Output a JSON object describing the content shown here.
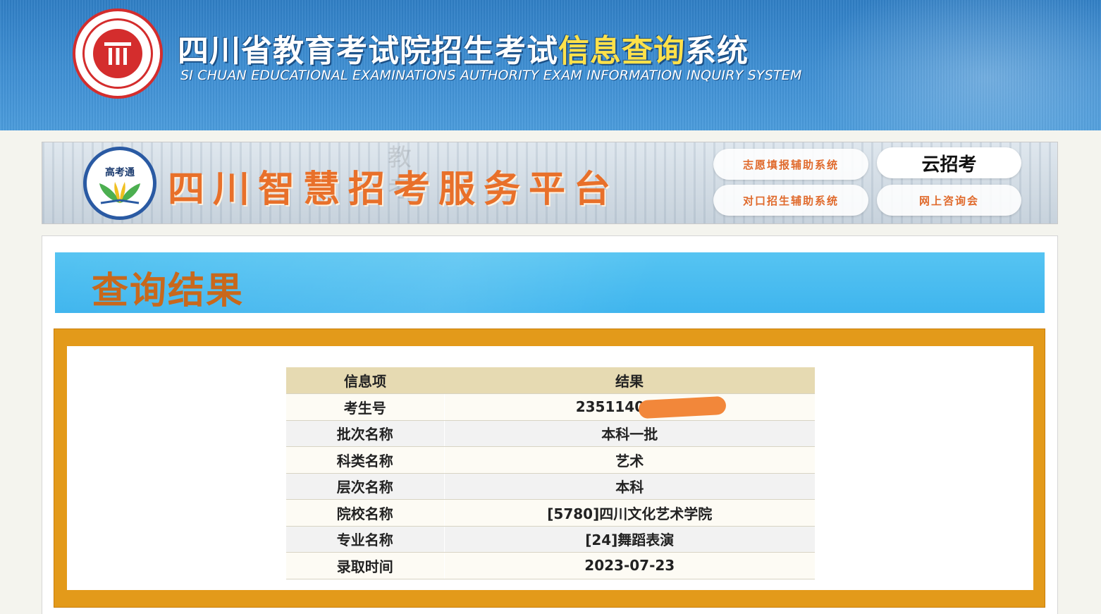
{
  "header": {
    "title_part1": "四川省教育考试院招生考试",
    "title_highlight": "信息查询",
    "title_part2": "系统",
    "subtitle": "SI CHUAN EDUCATIONAL EXAMINATIONS AUTHORITY EXAM INFORMATION INQUIRY SYSTEM"
  },
  "banner": {
    "logo_text": "高考通",
    "title": "四川智慧招考服务平台",
    "buttons": {
      "zhiyuan": "志愿填报辅助系统",
      "duikou": "对口招生辅助系统",
      "yunzhaokao": "云招考",
      "wangshang": "网上咨询会"
    }
  },
  "result": {
    "title": "查询结果",
    "columns": [
      "信息项",
      "结果"
    ],
    "rows": [
      {
        "label": "考生号",
        "value": "23511401139"
      },
      {
        "label": "批次名称",
        "value": "本科一批"
      },
      {
        "label": "科类名称",
        "value": "艺术"
      },
      {
        "label": "层次名称",
        "value": "本科"
      },
      {
        "label": "院校名称",
        "value": "[5780]四川文化艺术学院"
      },
      {
        "label": "专业名称",
        "value": "[24]舞蹈表演"
      },
      {
        "label": "录取时间",
        "value": "2023-07-23"
      }
    ]
  },
  "colors": {
    "header_blue": "#3f8fd3",
    "title_highlight": "#ffe14a",
    "banner_title_orange": "#e8702a",
    "result_header_blue": "#3fb5ee",
    "result_title_orange": "#c8681c",
    "frame_orange": "#e39a1a",
    "table_header_bg": "#e6dab2",
    "redaction_orange": "#f2873a"
  }
}
